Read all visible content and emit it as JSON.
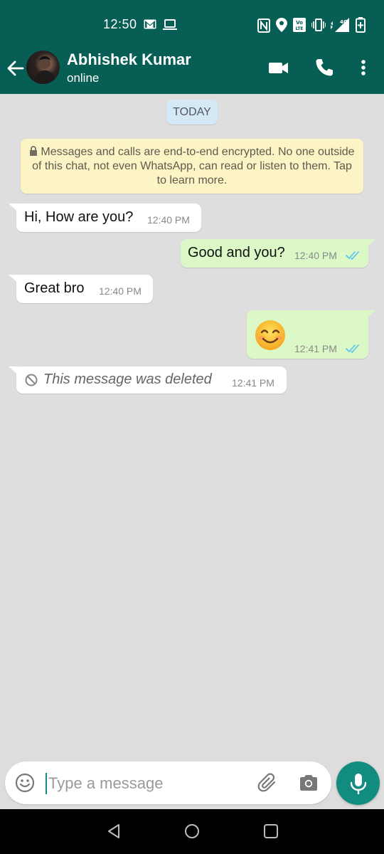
{
  "status_bar": {
    "time": "12:50",
    "left_icons": [
      "gmail-icon",
      "laptop-icon"
    ],
    "right_icons": [
      "nfc-icon",
      "location-icon",
      "volte-icon",
      "vibrate-icon",
      "signal-4g-icon",
      "battery-charging-icon"
    ],
    "network_label": "4G"
  },
  "header": {
    "contact_name": "Abhishek Kumar",
    "contact_status": "online",
    "actions": [
      "video-call-icon",
      "voice-call-icon",
      "more-options-icon"
    ]
  },
  "chat": {
    "date_chip": "TODAY",
    "encryption_notice": "Messages and calls are end-to-end encrypted. No one outside of this chat, not even WhatsApp, can read or listen to them. Tap to learn more.",
    "messages": [
      {
        "direction": "in",
        "text": "Hi, How are you?",
        "time": "12:40 PM"
      },
      {
        "direction": "out",
        "text": "Good and you?",
        "time": "12:40 PM",
        "status": "read"
      },
      {
        "direction": "in",
        "text": "Great bro",
        "time": "12:40 PM"
      },
      {
        "direction": "out",
        "text": "😊",
        "time": "12:41 PM",
        "status": "read",
        "kind": "emoji"
      },
      {
        "direction": "in",
        "text": "This message was deleted",
        "time": "12:41 PM",
        "kind": "deleted"
      }
    ]
  },
  "composer": {
    "placeholder": "Type a message",
    "value": ""
  },
  "colors": {
    "header": "#075e54",
    "chat_bg": "#dedede",
    "outgoing_bubble": "#dcf8c6",
    "incoming_bubble": "#ffffff",
    "read_ticks": "#4fc3f7",
    "mic_button": "#128c7e",
    "encryption_notice_bg": "#fdf4c5",
    "date_chip_bg": "#d4e9f5"
  }
}
